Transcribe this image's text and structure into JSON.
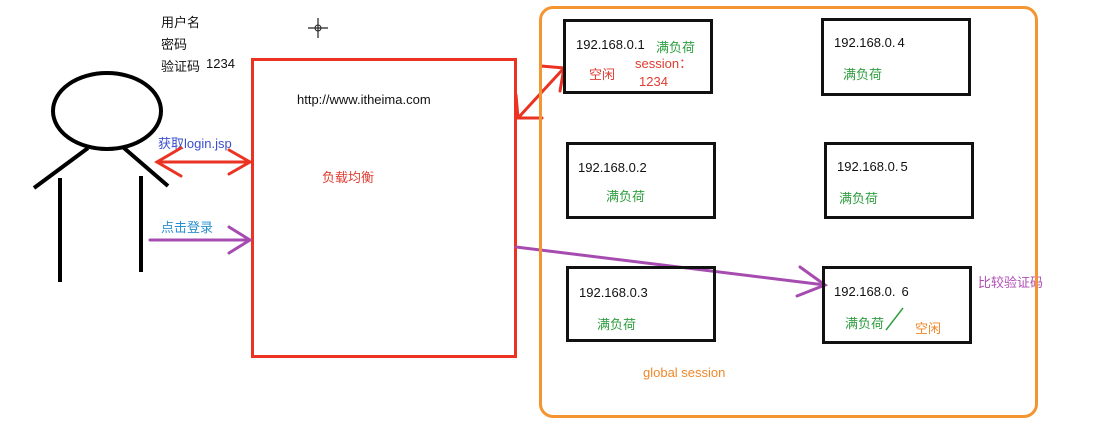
{
  "login_form": {
    "username_label": "用户名",
    "password_label": "密码",
    "captcha_label": "验证码",
    "captcha_value": "1234"
  },
  "load_balancer": {
    "url": "http://www.itheima.com",
    "label": "负载均衡"
  },
  "arrows": {
    "get_login": "获取login.jsp",
    "click_login": "点击登录",
    "compare_captcha": "比较验证码"
  },
  "cluster": {
    "label": "global session",
    "servers": [
      {
        "ip": "192.168.0.1",
        "status": "满负荷",
        "alt_status": "空闲",
        "session_label": "session：",
        "session_value": "1234"
      },
      {
        "ip": "192.168.0.2",
        "status": "满负荷"
      },
      {
        "ip": "192.168.0.3",
        "status": "满负荷"
      },
      {
        "ip_prefix": "192.168.0.",
        "ip_suffix": "4",
        "status": "满负荷"
      },
      {
        "ip_prefix": "192.168.0.",
        "ip_suffix": "5",
        "status": "满负荷"
      },
      {
        "ip_prefix": "192.168.0.",
        "ip_suffix": "6",
        "status": "满负荷",
        "alt_status": "空闲"
      }
    ]
  },
  "colors": {
    "server_border": "#111111",
    "load_balancer_border": "#ea3323",
    "cluster_border": "#f39530",
    "status_green": "#2f9e3f",
    "idle_red": "#e03c31",
    "idle_orange": "#f0882a",
    "arrow_red": "#ea3323",
    "arrow_purple": "#a64cb0"
  }
}
